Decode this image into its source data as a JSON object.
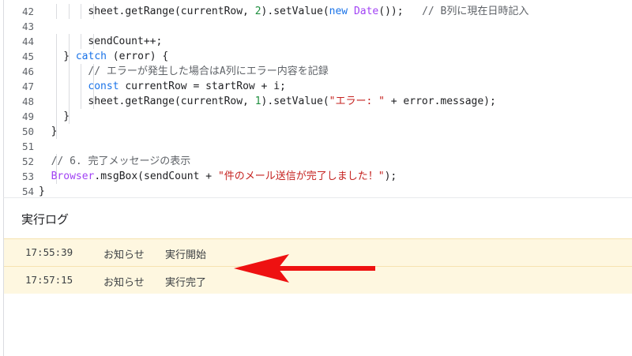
{
  "editor": {
    "lines": [
      {
        "num": "42",
        "indent": 4,
        "tokens": [
          {
            "t": "sheet.getRange(currentRow, "
          },
          {
            "t": "2",
            "c": "num"
          },
          {
            "t": ").setValue("
          },
          {
            "t": "new",
            "c": "kw"
          },
          {
            "t": " "
          },
          {
            "t": "Date",
            "c": "cls"
          },
          {
            "t": "());   "
          },
          {
            "t": "// B列に現在日時記入",
            "c": "cmt"
          }
        ]
      },
      {
        "num": "43",
        "indent": 0,
        "tokens": []
      },
      {
        "num": "44",
        "indent": 4,
        "tokens": [
          {
            "t": "sendCount++;"
          }
        ]
      },
      {
        "num": "45",
        "indent": 2,
        "tokens": [
          {
            "t": "} "
          },
          {
            "t": "catch",
            "c": "kw"
          },
          {
            "t": " (error) {"
          }
        ]
      },
      {
        "num": "46",
        "indent": 4,
        "tokens": [
          {
            "t": "// エラーが発生した場合はA列にエラー内容を記録",
            "c": "cmt"
          }
        ]
      },
      {
        "num": "47",
        "indent": 4,
        "tokens": [
          {
            "t": "const",
            "c": "kw"
          },
          {
            "t": " currentRow = startRow + i;"
          }
        ]
      },
      {
        "num": "48",
        "indent": 4,
        "tokens": [
          {
            "t": "sheet.getRange(currentRow, "
          },
          {
            "t": "1",
            "c": "num"
          },
          {
            "t": ").setValue("
          },
          {
            "t": "\"エラー: \"",
            "c": "str"
          },
          {
            "t": " + error.message);"
          }
        ]
      },
      {
        "num": "49",
        "indent": 2,
        "tokens": [
          {
            "t": "}"
          }
        ]
      },
      {
        "num": "50",
        "indent": 1,
        "tokens": [
          {
            "t": "}"
          }
        ]
      },
      {
        "num": "51",
        "indent": 0,
        "tokens": []
      },
      {
        "num": "52",
        "indent": 1,
        "tokens": [
          {
            "t": "// 6. 完了メッセージの表示",
            "c": "cmt"
          }
        ]
      },
      {
        "num": "53",
        "indent": 1,
        "tokens": [
          {
            "t": "Browser",
            "c": "cls"
          },
          {
            "t": ".msgBox(sendCount + "
          },
          {
            "t": "\"件のメール送信が完了しました！\"",
            "c": "str"
          },
          {
            "t": ");"
          }
        ]
      },
      {
        "num": "54",
        "indent": 0,
        "tokens": [
          {
            "t": "}"
          }
        ]
      }
    ]
  },
  "log": {
    "title": "実行ログ",
    "entries": [
      {
        "time": "17:55:39",
        "level": "お知らせ",
        "message": "実行開始"
      },
      {
        "time": "17:57:15",
        "level": "お知らせ",
        "message": "実行完了"
      }
    ]
  },
  "colors": {
    "arrow": "#ee1111",
    "log_row_bg": "#fef7e0"
  }
}
